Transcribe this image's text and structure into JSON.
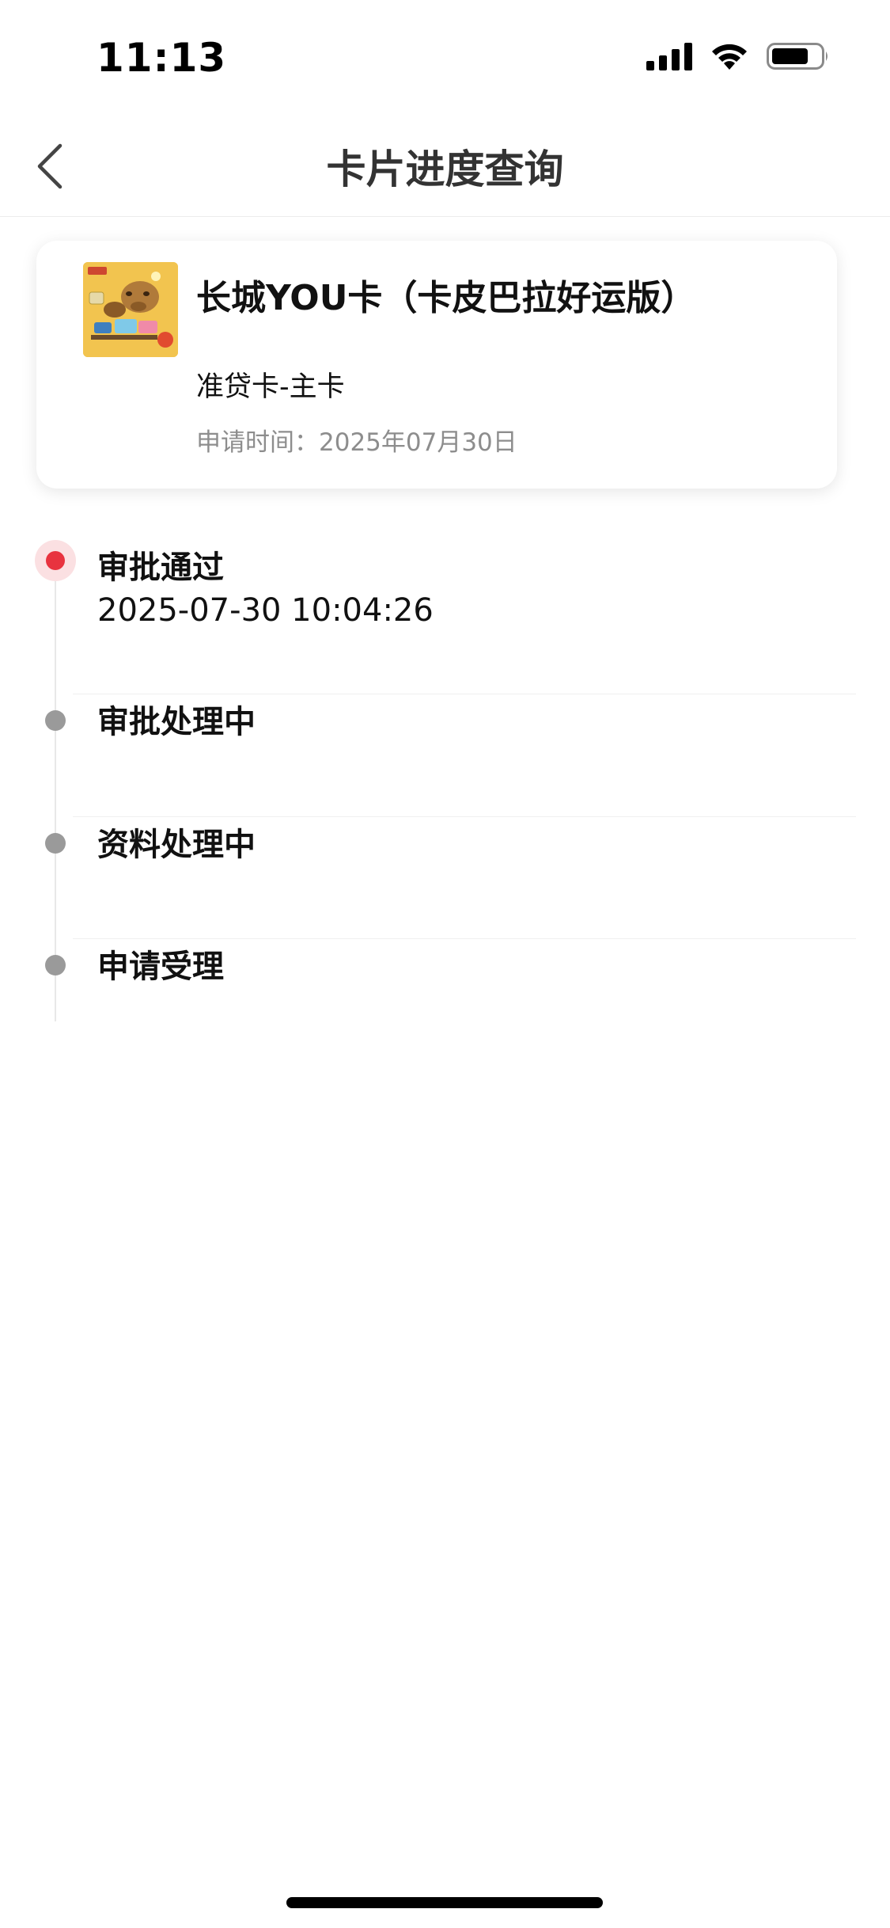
{
  "status_bar": {
    "time": "11:13"
  },
  "nav": {
    "title": "卡片进度查询"
  },
  "card": {
    "name": "长城YOU卡（卡皮巴拉好运版）",
    "type": "准贷卡-主卡",
    "apply_date": "申请时间：2025年07月30日"
  },
  "timeline": {
    "steps": [
      {
        "label": "审批通过",
        "time": "2025-07-30 10:04:26",
        "status": "active"
      },
      {
        "label": "审批处理中",
        "status": "pending"
      },
      {
        "label": "资料处理中",
        "status": "pending"
      },
      {
        "label": "申请受理",
        "status": "pending"
      }
    ]
  },
  "colors": {
    "active_dot": "#e8333f",
    "pending_dot": "#9a9a9a",
    "card_art": "#f2c44f"
  }
}
